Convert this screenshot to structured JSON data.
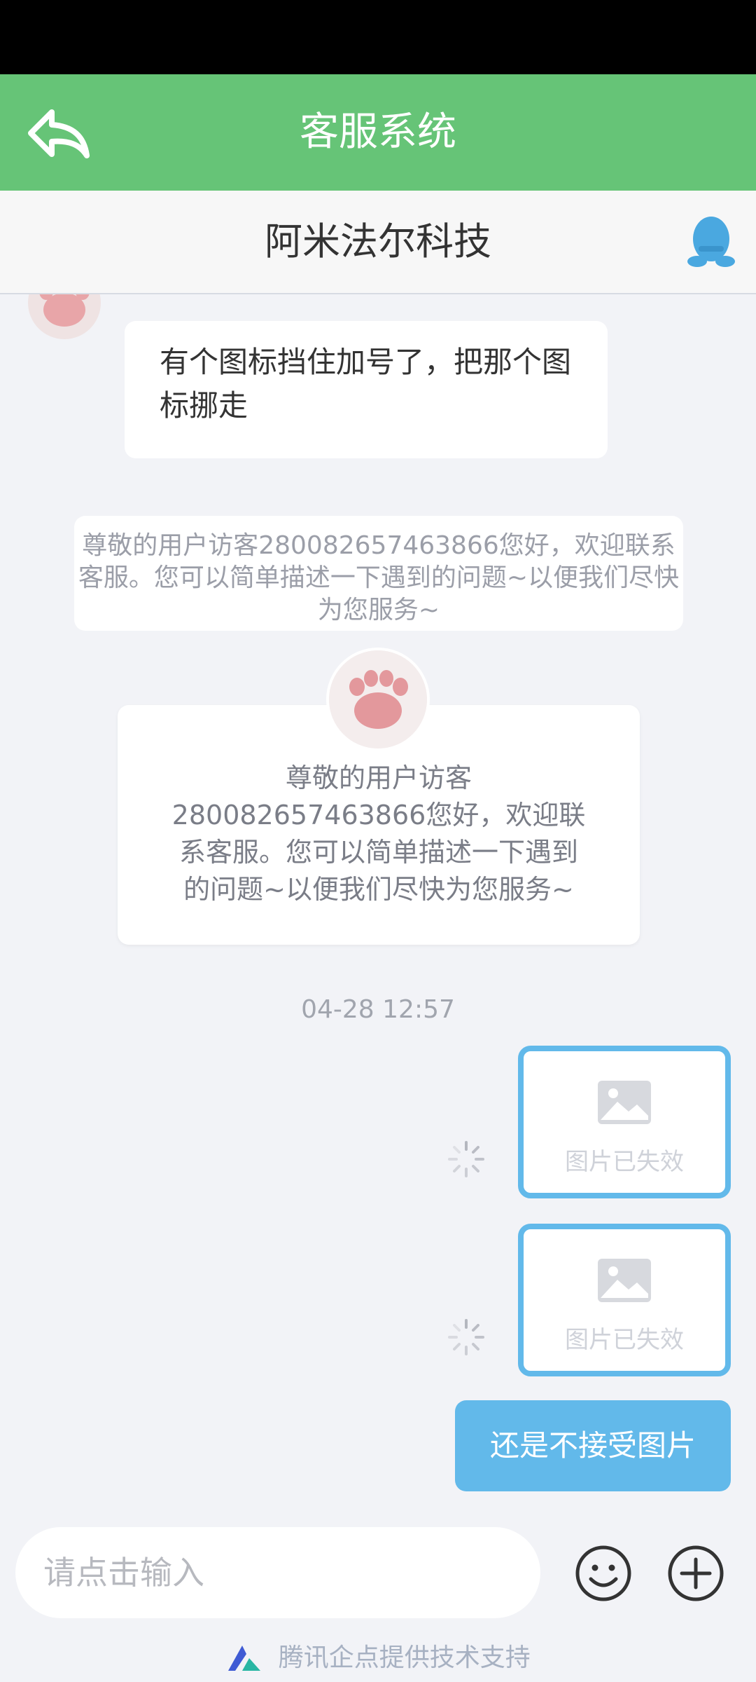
{
  "header": {
    "title": "客服系统"
  },
  "sub_header": {
    "company": "阿米法尔科技"
  },
  "messages": {
    "user_text": "有个图标挡住加号了，把那个图标挪走",
    "system_notice": "尊敬的用户访客280082657463866您好，欢迎联系客服。您可以简单描述一下遇到的问题~以便我们尽快为您服务~",
    "welcome_card": "尊敬的用户访客280082657463866您好，欢迎联系客服。您可以简单描述一下遇到的问题~以便我们尽快为您服务~",
    "timestamp": "04-28 12:57",
    "expired_image_1": "图片已失效",
    "expired_image_2": "图片已失效",
    "outgoing_text": "还是不接受图片"
  },
  "input": {
    "placeholder": "请点击输入"
  },
  "footer": {
    "text": "腾讯企点提供技术支持"
  },
  "colors": {
    "header": "#66c477",
    "bubble_blue": "#62b9ea",
    "background": "#f2f3f7"
  },
  "icons": [
    "back-arrow-icon",
    "qq-penguin-icon",
    "cat-paw-avatar",
    "broken-image-icon",
    "loading-spinner-icon",
    "emoji-icon",
    "plus-icon",
    "qidian-logo-icon"
  ]
}
